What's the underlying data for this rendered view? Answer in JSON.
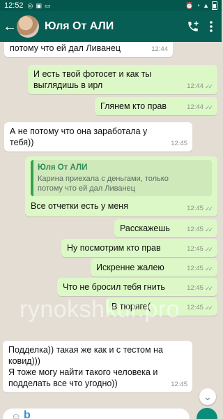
{
  "status_bar": {
    "time": "12:52"
  },
  "header": {
    "contact_name": "Юля От АЛИ"
  },
  "messages": [
    {
      "dir": "in",
      "text": "потому что ей дал Ливанец",
      "time": "12:44"
    },
    {
      "dir": "out",
      "text": "И есть твой фотосет и как ты\nвыглядишь в ирл",
      "time": "12:44"
    },
    {
      "dir": "out",
      "text": "Глянем кто прав",
      "time": "12:44"
    },
    {
      "dir": "in",
      "text": "А не потому что она заработала у\nтебя))",
      "time": "12:45"
    },
    {
      "dir": "out",
      "text": "Все отчетки есть у меня",
      "time": "12:45",
      "quote": {
        "name": "Юля От АЛИ",
        "text": "Карина приехала с деньгами, только\nпотому что ей дал Ливанец"
      }
    },
    {
      "dir": "out",
      "text": "Расскажешь",
      "time": "12:45"
    },
    {
      "dir": "out",
      "text": "Ну посмотрим кто прав",
      "time": "12:45"
    },
    {
      "dir": "out",
      "text": "Искренне  жалею",
      "time": "12:45"
    },
    {
      "dir": "out",
      "text": "Что не бросил тебя гнить",
      "time": "12:45"
    },
    {
      "dir": "out",
      "text": "В тюряге(",
      "time": "12:45"
    },
    {
      "dir": "in",
      "text": "Подделка)) такая же как и с тестом на\nковид)))\nЯ тоже могу найти такого человека и\nподделать все что угодно))",
      "time": "12:45"
    }
  ],
  "watermark": "rynokshkur.pro",
  "icons": {
    "back": "arrow-left-icon",
    "call": "add-call-icon",
    "menu": "more-vert-icon",
    "scroll": "chevron-down-icon"
  },
  "colors": {
    "header": "#075e54",
    "status_bar": "#04574d",
    "outgoing": "#dcf8c6",
    "incoming": "#ffffff",
    "chat_bg": "#e4ddd4"
  }
}
